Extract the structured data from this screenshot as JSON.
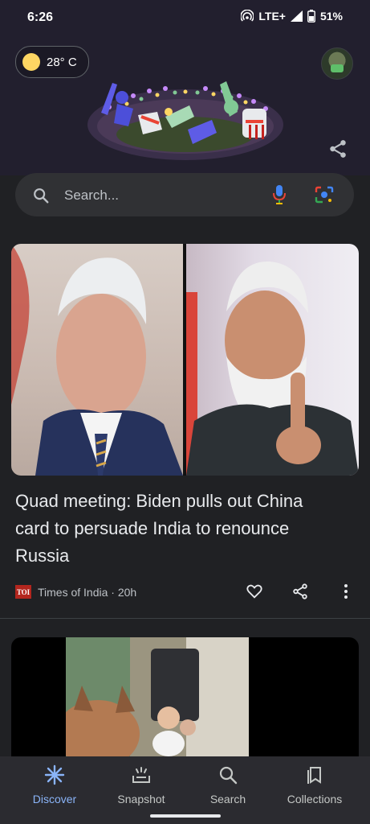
{
  "status": {
    "time": "6:26",
    "network": "LTE+",
    "battery": "51%"
  },
  "weather": {
    "temperature": "28° C"
  },
  "search": {
    "placeholder": "Search..."
  },
  "article1": {
    "headline": "Quad meeting: Biden pulls out China card to persuade India to renounce Russia",
    "source_logo": "TOI",
    "source": "Times of India",
    "age": "20h"
  },
  "nav": {
    "items": [
      {
        "label": "Discover",
        "icon": "discover-icon",
        "active": true
      },
      {
        "label": "Snapshot",
        "icon": "snapshot-icon",
        "active": false
      },
      {
        "label": "Search",
        "icon": "search-icon",
        "active": false
      },
      {
        "label": "Collections",
        "icon": "collections-icon",
        "active": false
      }
    ]
  },
  "colors": {
    "accent": "#8ab4f8",
    "background": "#202124",
    "header": "#221f2e"
  }
}
